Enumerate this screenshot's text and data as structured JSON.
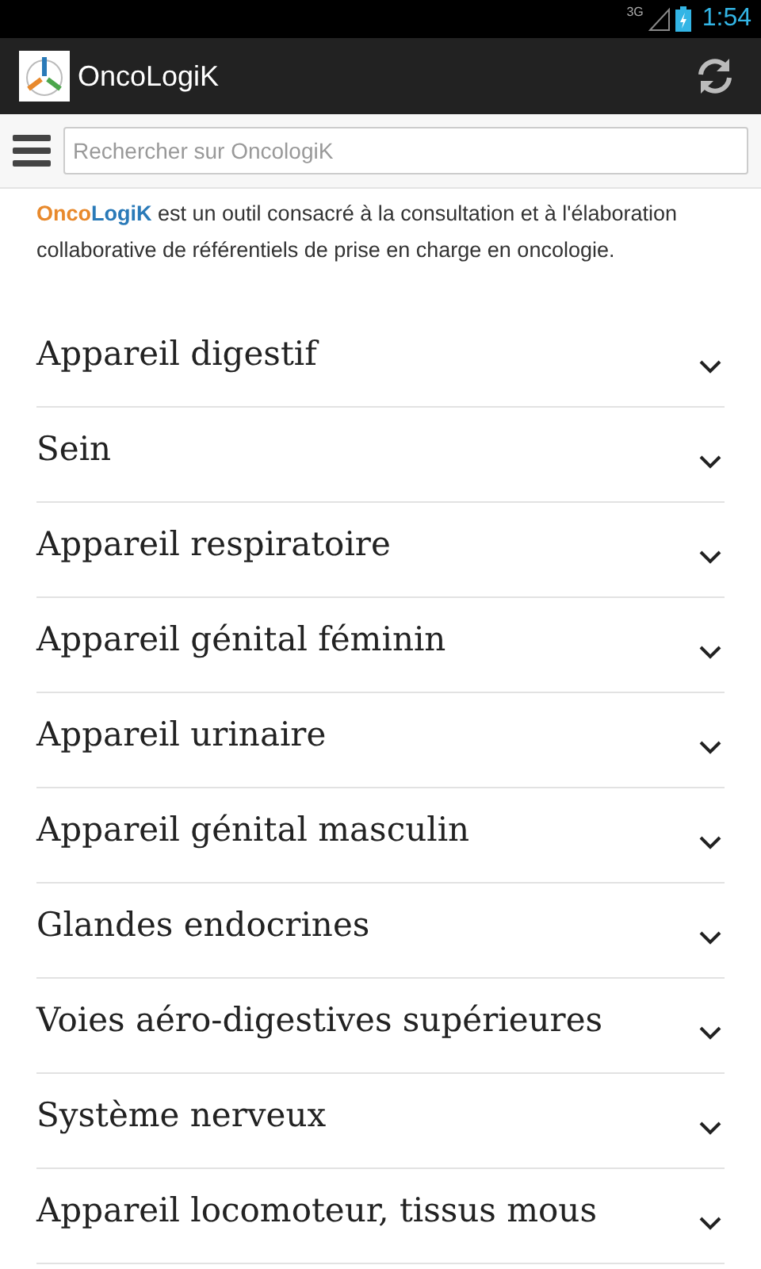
{
  "status_bar": {
    "network": "3G",
    "time": "1:54"
  },
  "app_bar": {
    "title": "OncoLogiK"
  },
  "search": {
    "placeholder": "Rechercher sur OncologiK"
  },
  "intro": {
    "brand_first": "Onco",
    "brand_second": "LogiK",
    "text": " est un outil consacré à la consultation et à l'élaboration collaborative de référentiels de prise en charge en oncologie."
  },
  "sections": [
    {
      "label": "Appareil digestif",
      "expanded": false
    },
    {
      "label": "Sein",
      "expanded": false
    },
    {
      "label": "Appareil respiratoire",
      "expanded": false
    },
    {
      "label": "Appareil génital féminin",
      "expanded": false
    },
    {
      "label": "Appareil urinaire",
      "expanded": false
    },
    {
      "label": "Appareil génital masculin",
      "expanded": false
    },
    {
      "label": "Glandes endocrines",
      "expanded": false
    },
    {
      "label": "Voies aéro-digestives supérieures",
      "expanded": false
    },
    {
      "label": "Système nerveux",
      "expanded": false
    },
    {
      "label": "Appareil locomoteur, tissus mous",
      "expanded": false
    }
  ]
}
